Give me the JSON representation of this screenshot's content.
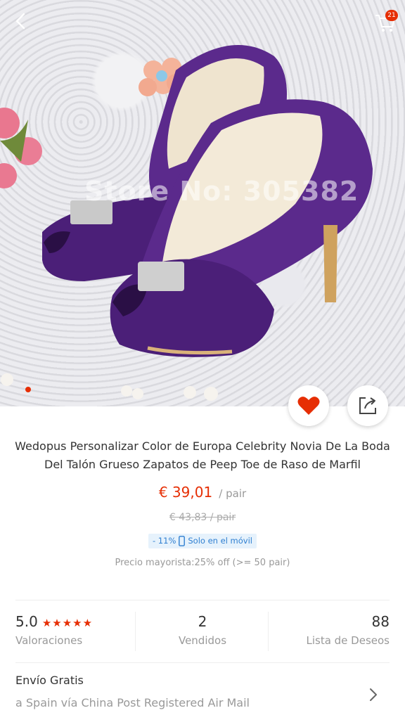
{
  "header": {
    "back_icon": "chevron-left-icon",
    "cart_icon": "cart-icon",
    "cart_count": "21"
  },
  "hero": {
    "watermark": "Store No: 305382",
    "gallery_active_index": 1
  },
  "actions": {
    "favorite_icon": "heart-icon",
    "share_icon": "share-icon"
  },
  "product": {
    "title": "Wedopus Personalizar Color de Europa Celebrity Novia De La Boda Del Talón Grueso Zapatos de Peep Toe de Raso de Marfil",
    "price": "€ 39,01",
    "price_unit": "/ pair",
    "old_price": "€ 43,83  / pair",
    "discount": "- 11%",
    "mobile_only": "Solo en el móvil",
    "wholesale": "Precio mayorista:25% off (>= 50 pair)"
  },
  "stats": {
    "rating_value": "5.0",
    "rating_stars": "★★★★★",
    "rating_label": "Valoraciones",
    "sold_value": "2",
    "sold_label": "Vendidos",
    "wishlist_value": "88",
    "wishlist_label": "Lista de Deseos"
  },
  "shipping": {
    "title": "Envío Gratis",
    "detail": "a Spain vía China Post Registered Air Mail"
  },
  "colors": {
    "accent": "#e62e04",
    "muted": "#999999",
    "badge_bg": "#e6f2fc",
    "badge_text": "#2f7fd1",
    "shoe_purple": "#5b2a8c"
  }
}
